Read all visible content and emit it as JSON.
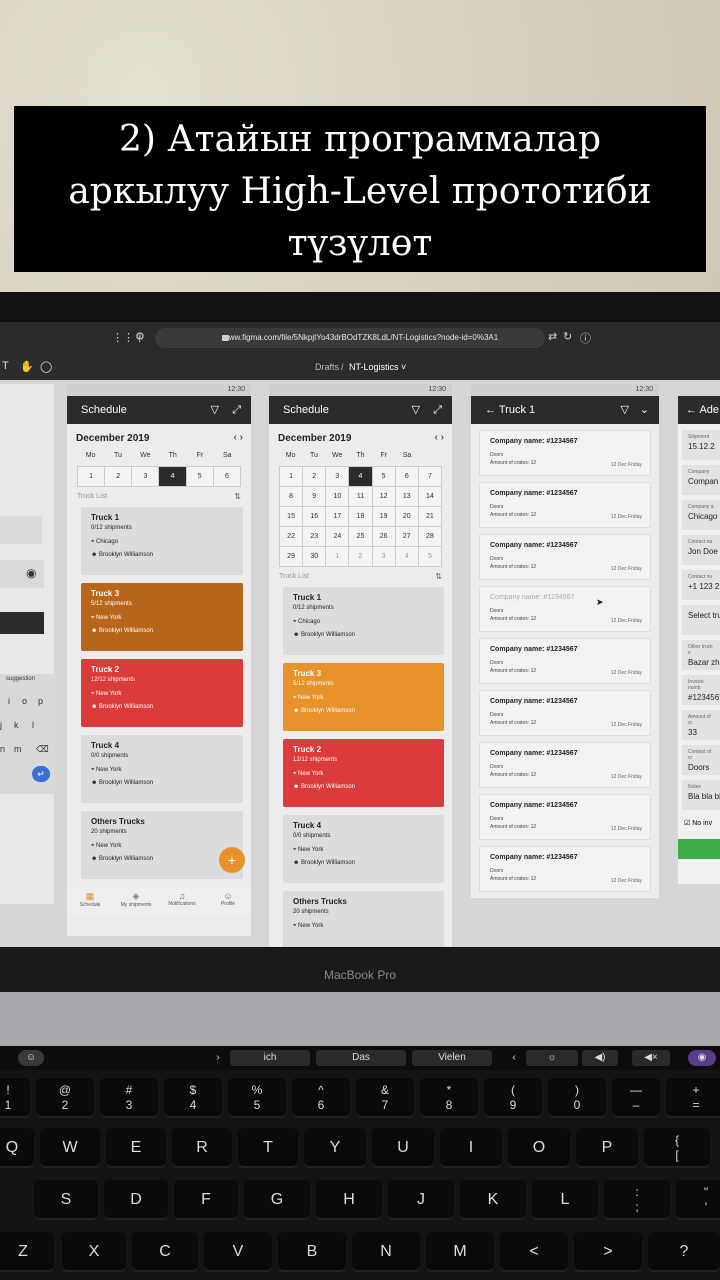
{
  "caption": {
    "line1": "2) Атайын программалар",
    "line2": "аркылуу High-Level прототиби",
    "line3": "түзүлөт"
  },
  "browser": {
    "url": "www.figma.com/file/5NkpjtYo43drBOdTZK8LdL/NT-Logistics?node-id=0%3A1"
  },
  "figma": {
    "breadcrumb_drafts": "Drafts",
    "breadcrumb_sep": "/",
    "breadcrumb_file": "NT-Logistics ˅"
  },
  "status_time": "12:30",
  "schedule": {
    "title": "Schedule",
    "month": "December 2019",
    "weekdays": [
      "Mo",
      "Tu",
      "We",
      "Th",
      "Fr",
      "Sa"
    ],
    "truck_list_label": "Truck List",
    "cards": [
      {
        "title": "Truck 1",
        "shipments": "0/12 shipments",
        "city": "Chicago",
        "person": "Brooklyn Williamson"
      },
      {
        "title": "Truck 3",
        "shipments": "5/12 shipments",
        "city": "New York",
        "person": "Brooklyn Williamson"
      },
      {
        "title": "Truck 2",
        "shipments": "12/12 shipments",
        "city": "New York",
        "person": "Brooklyn Williamson"
      },
      {
        "title": "Truck 4",
        "shipments": "0/0 shipments",
        "city": "New York",
        "person": "Brooklyn Williamson"
      },
      {
        "title": "Others  Trucks",
        "shipments": "20 shipments",
        "city": "New York",
        "person": "Brooklyn Williamson"
      }
    ],
    "fab": "+",
    "nav": [
      "Schedule",
      "My shipments",
      "Notifications",
      "Profile"
    ]
  },
  "calendar": {
    "row1": [
      "1",
      "2",
      "3",
      "4",
      "5",
      "6",
      "7"
    ],
    "row2": [
      "8",
      "9",
      "10",
      "11",
      "12",
      "13",
      "14"
    ],
    "row3": [
      "15",
      "16",
      "17",
      "18",
      "19",
      "20",
      "21"
    ],
    "row4": [
      "22",
      "23",
      "24",
      "25",
      "26",
      "27",
      "28"
    ],
    "row5": [
      "29",
      "30",
      "1",
      "2",
      "3",
      "4",
      "5"
    ],
    "weekdays7": [
      "Mo",
      "Tu",
      "We",
      "Th",
      "Fr",
      "Sa"
    ]
  },
  "truck1": {
    "title": "Truck 1",
    "company": "Company name: #1234567",
    "doors": "Doors",
    "crates": "Amount of crates: 12",
    "date": "12 Dec Friday"
  },
  "form": {
    "title": "Ade",
    "fields": [
      {
        "label": "Shipment",
        "value": "15.12.2"
      },
      {
        "label": "Company",
        "value": "Compan"
      },
      {
        "label": "Company a",
        "value": "Chicago"
      },
      {
        "label": "Contact na",
        "value": "Jon Doe"
      },
      {
        "label": "Contact nu",
        "value": "+1 123 2"
      },
      {
        "label": "",
        "value": "Select tru"
      },
      {
        "label": "Other truck s",
        "value": "Bazar zho"
      },
      {
        "label": "Invoice numb",
        "value": "#1234567"
      },
      {
        "label": "Amount of cr",
        "value": "33"
      },
      {
        "label": "Content of cr",
        "value": "Doors"
      },
      {
        "label": "Notes",
        "value": "Bla bla bla"
      }
    ],
    "checkbox": "No inv"
  },
  "keyboard_panel": {
    "suggestion": "suggestion",
    "row1": [
      "i",
      "o",
      "p"
    ],
    "row2": [
      "j",
      "k",
      "l"
    ],
    "row3": [
      "n",
      "m"
    ]
  },
  "laptop_brand": "MacBook Pro",
  "touchbar": {
    "w1": "ich",
    "w2": "Das",
    "w3": "Vielen"
  },
  "keys": {
    "num": [
      [
        "@",
        "2"
      ],
      [
        "#",
        "3"
      ],
      [
        "$",
        "4"
      ],
      [
        "%",
        "5"
      ],
      [
        "^",
        "6"
      ],
      [
        "&",
        "7"
      ],
      [
        "*",
        "8"
      ],
      [
        "(",
        "9"
      ],
      [
        ")",
        "0"
      ],
      [
        "—",
        "–"
      ],
      [
        "+",
        "="
      ]
    ],
    "row_q": [
      "Q",
      "W",
      "E",
      "R",
      "T",
      "Y",
      "U",
      "I",
      "O",
      "P",
      "{\n["
    ],
    "row_a": [
      "S",
      "D",
      "F",
      "G",
      "H",
      "J",
      "K",
      "L",
      ":\n;",
      "\"\n'"
    ],
    "row_z": [
      "Z",
      "X",
      "C",
      "V",
      "B",
      "N",
      "M",
      "<",
      "> ",
      "?"
    ]
  }
}
